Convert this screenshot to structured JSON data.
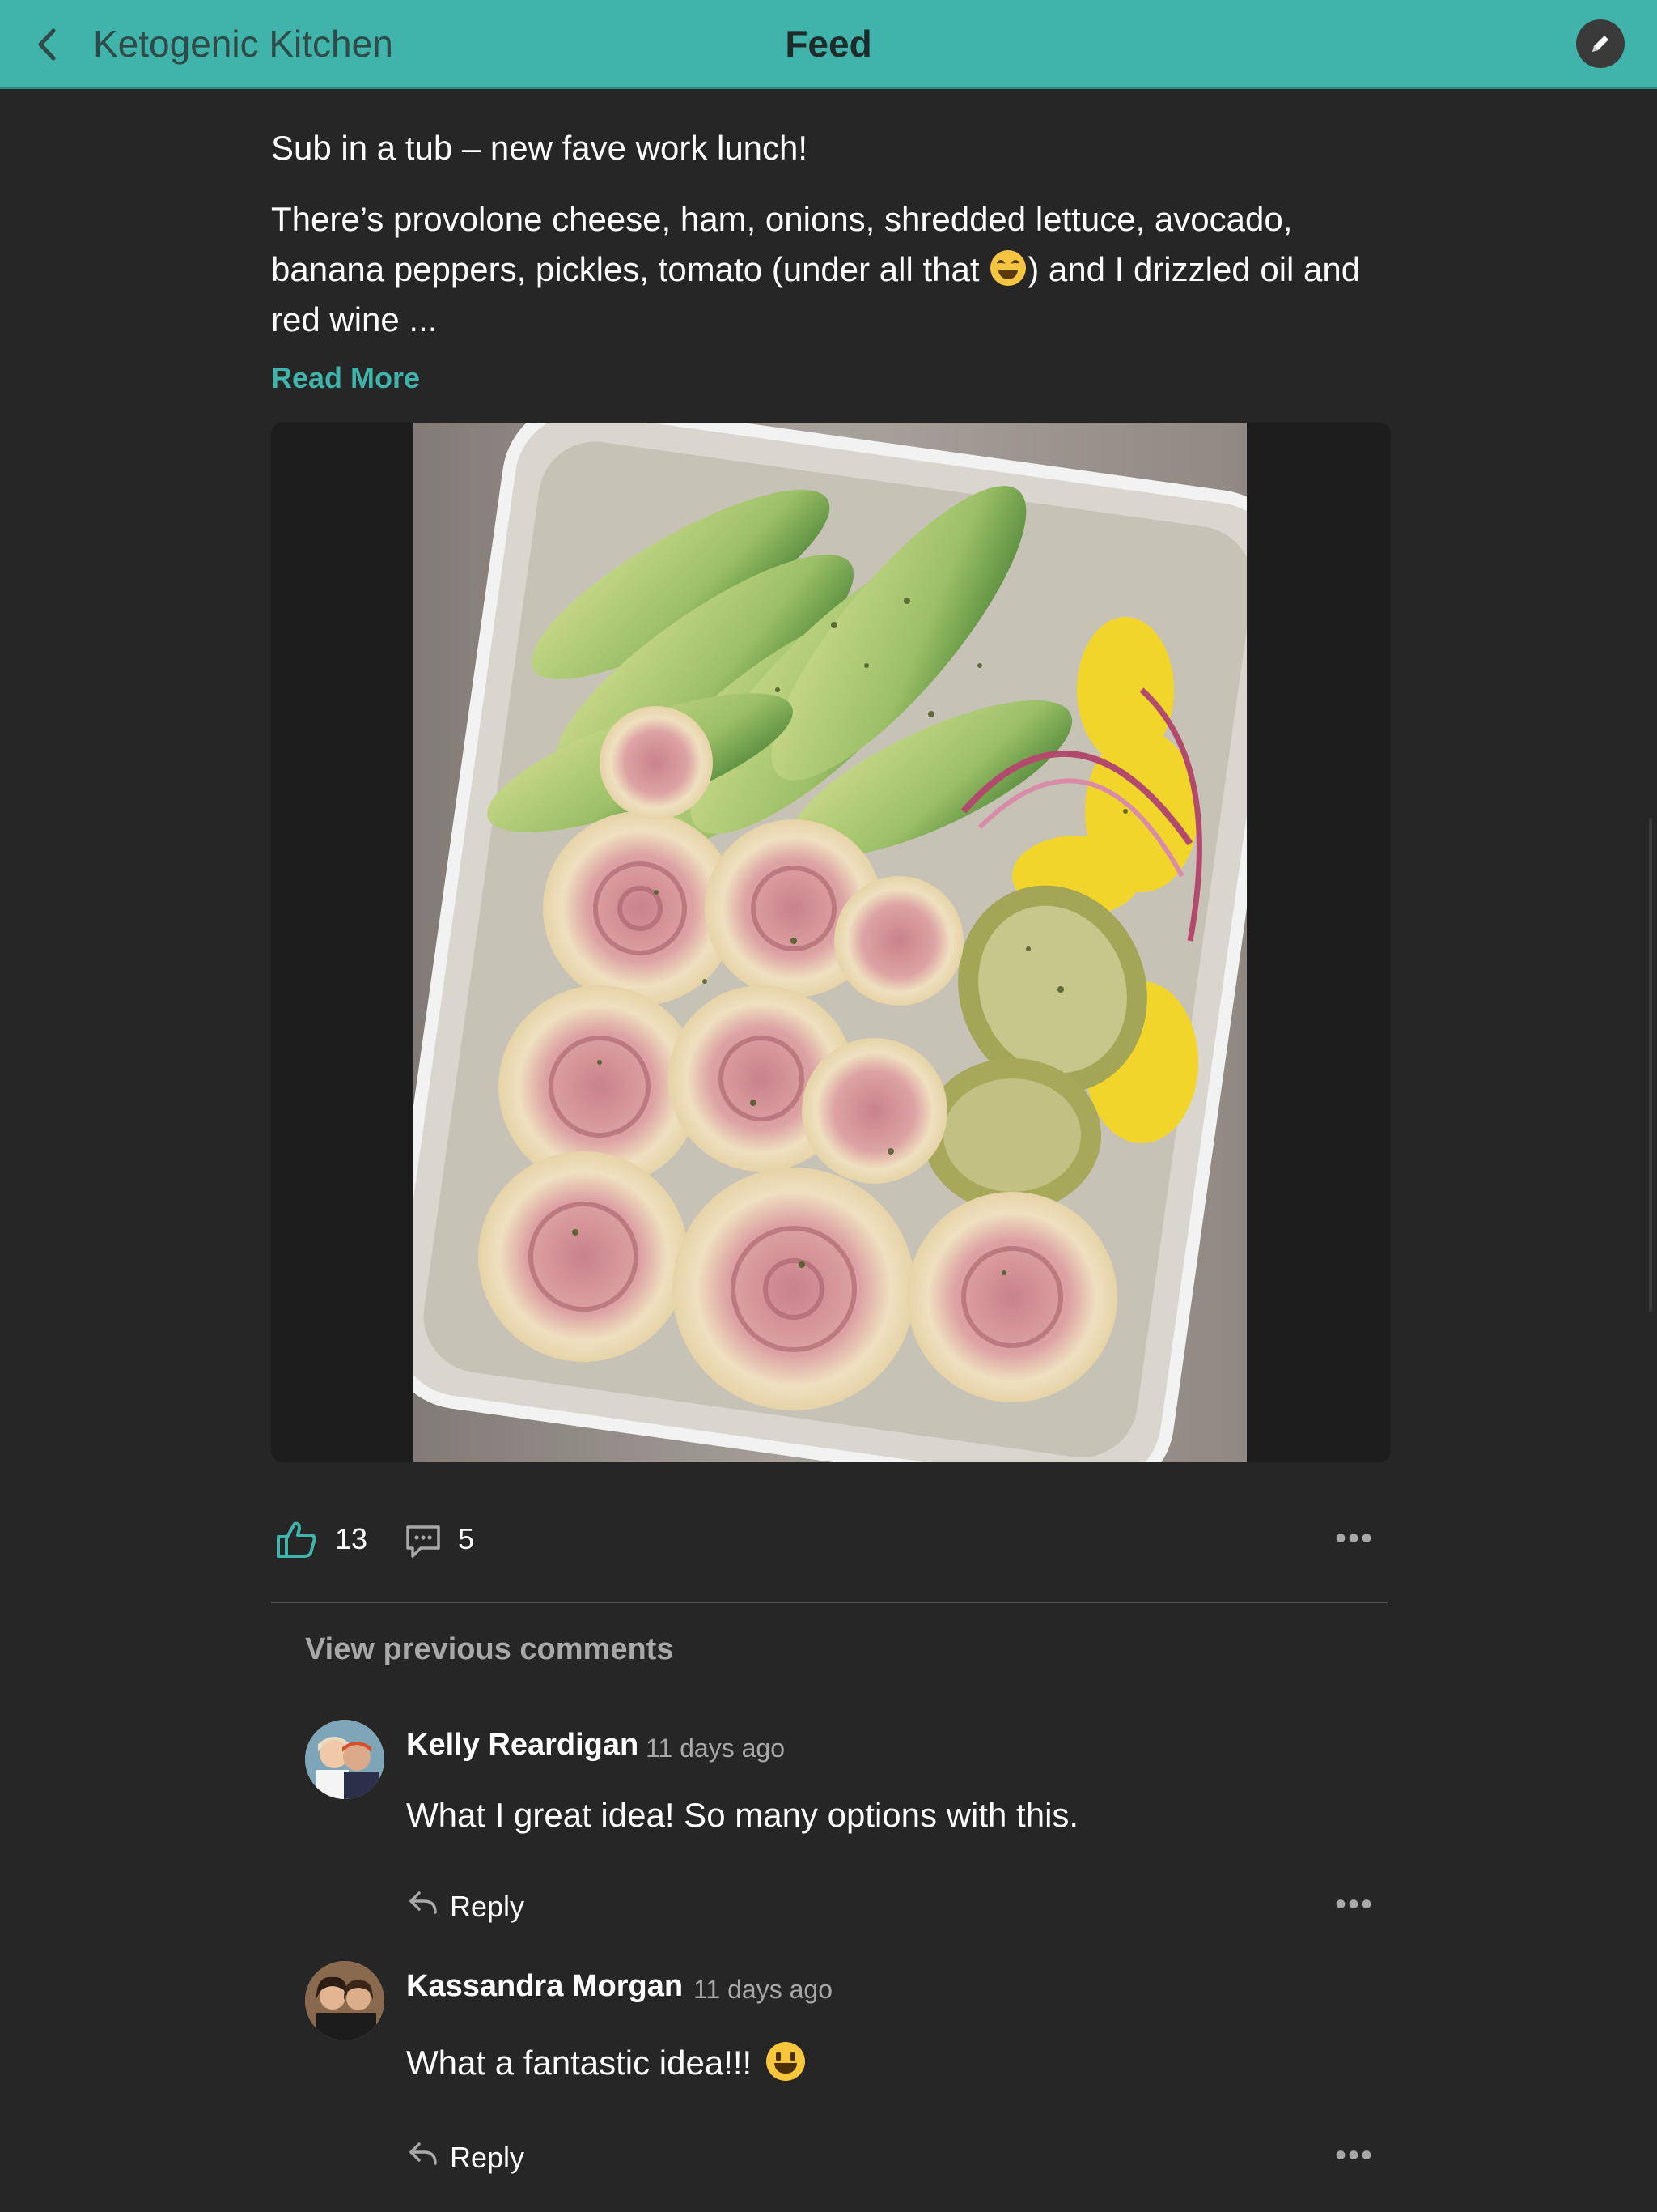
{
  "header": {
    "back_label": "Back",
    "group_name": "Ketogenic Kitchen",
    "title": "Feed",
    "compose_label": "Compose"
  },
  "post": {
    "title": "Sub in a tub – new fave work lunch!",
    "body_part1": "There’s provolone cheese, ham, onions, shredded lettuce, avocado, banana peppers, pickles, tomato (under all that ",
    "body_part2": ") and I drizzled oil and red wine ...",
    "read_more": "Read More",
    "image_alt": "Rolled ham and provolone with avocado, banana peppers and pickles in a plastic container",
    "like_count": "13",
    "comment_count": "5",
    "more_label": "•••"
  },
  "comments_section": {
    "view_previous": "View previous comments"
  },
  "comments": [
    {
      "author": "Kelly Reardigan",
      "time": "11 days ago",
      "text": "What I great idea! So many options with this.",
      "reply_label": "Reply",
      "more_label": "•••"
    },
    {
      "author": "Kassandra Morgan",
      "time": "11 days ago",
      "text": "What a fantastic idea!!!",
      "reply_label": "Reply",
      "more_label": "•••"
    }
  ],
  "colors": {
    "accent": "#40b3aa",
    "background": "#262626",
    "muted": "#a8a8a8"
  },
  "icons": [
    "back-chevron-icon",
    "pencil-icon",
    "thumbs-up-icon",
    "comment-bubble-icon",
    "reply-arrow-icon",
    "more-dots-icon"
  ]
}
